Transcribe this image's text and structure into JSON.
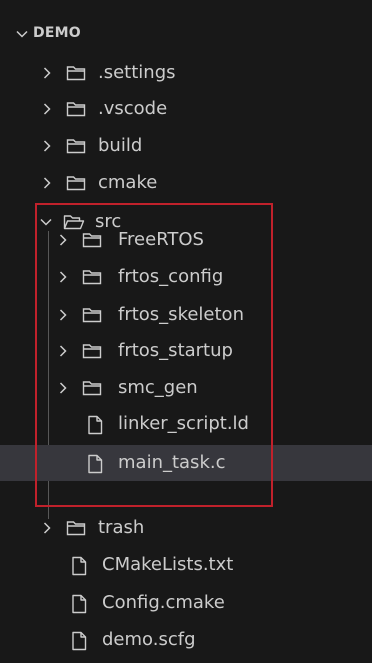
{
  "explorer": {
    "root": {
      "label": "DEMO",
      "expanded": true
    },
    "items": [
      {
        "label": ".settings",
        "type": "folder",
        "expanded": false
      },
      {
        "label": ".vscode",
        "type": "folder",
        "expanded": false
      },
      {
        "label": "build",
        "type": "folder",
        "expanded": false
      },
      {
        "label": "cmake",
        "type": "folder",
        "expanded": false
      },
      {
        "label": "src",
        "type": "folder",
        "expanded": true,
        "children": [
          {
            "label": "FreeRTOS",
            "type": "folder",
            "expanded": false
          },
          {
            "label": "frtos_config",
            "type": "folder",
            "expanded": false
          },
          {
            "label": "frtos_skeleton",
            "type": "folder",
            "expanded": false
          },
          {
            "label": "frtos_startup",
            "type": "folder",
            "expanded": false
          },
          {
            "label": "smc_gen",
            "type": "folder",
            "expanded": false
          },
          {
            "label": "linker_script.ld",
            "type": "file"
          },
          {
            "label": "main_task.c",
            "type": "file",
            "selected": true
          }
        ]
      },
      {
        "label": "trash",
        "type": "folder",
        "expanded": false
      },
      {
        "label": "CMakeLists.txt",
        "type": "file"
      },
      {
        "label": "Config.cmake",
        "type": "file"
      },
      {
        "label": "demo.scfg",
        "type": "file"
      }
    ]
  },
  "colors": {
    "background": "#181818",
    "text": "#cccccc",
    "selection": "#37373d",
    "highlight_border": "#c0212b"
  }
}
